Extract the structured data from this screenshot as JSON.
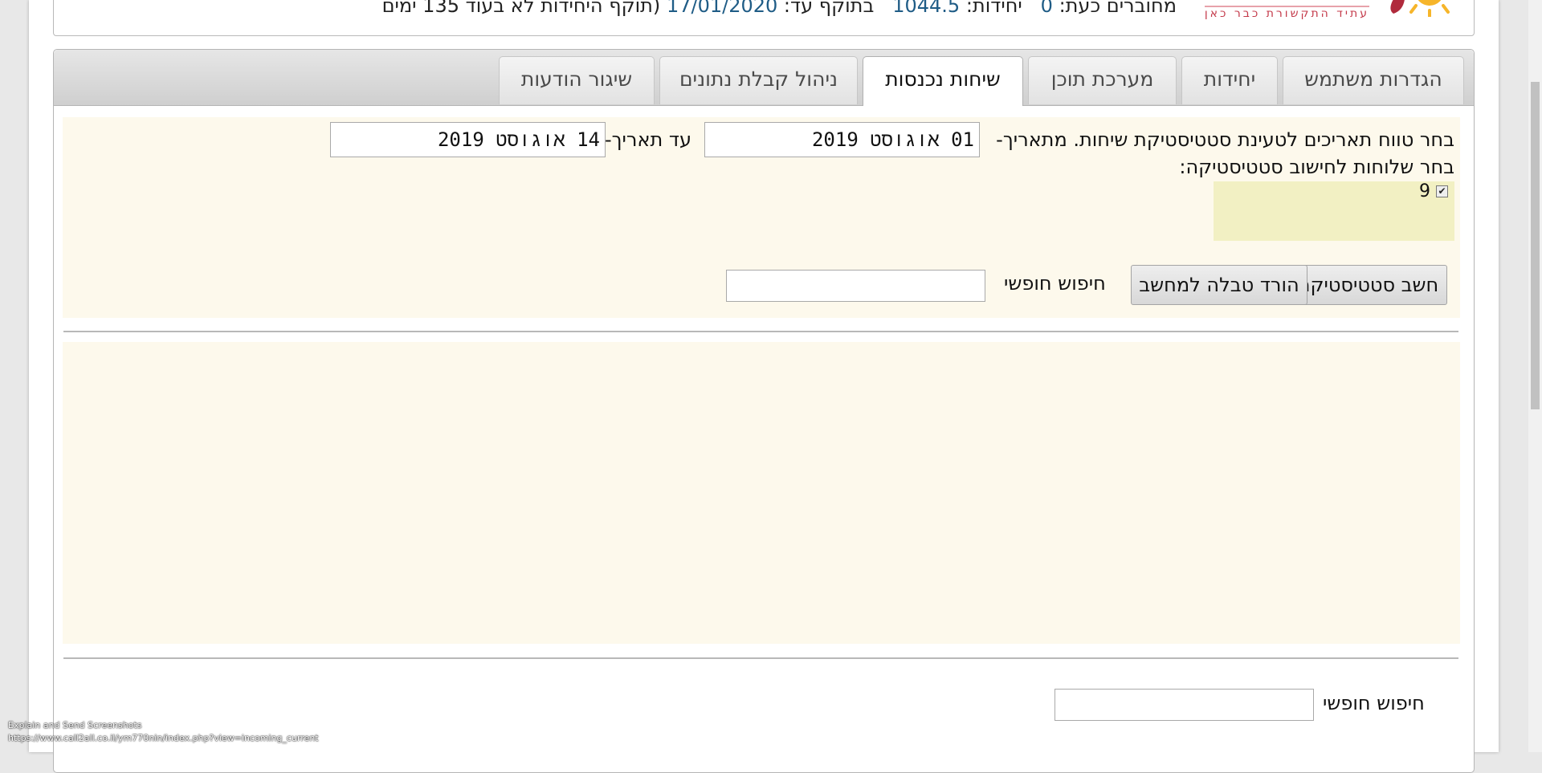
{
  "header": {
    "stats_text_1": "מחוברים כעת:",
    "stats_value_1": "0",
    "stats_text_2": "יחידות:",
    "stats_value_2": "1044.5",
    "stats_text_3": "בתוקף עד:",
    "stats_value_3": "17/01/2020",
    "stats_text_4": "(תוקף היחידות לא בעוד 135 ימים",
    "logo_tagline": "עתיד התקשורת כבר כאן"
  },
  "tabs": [
    {
      "label": "הגדרות משתמש",
      "active": false
    },
    {
      "label": "יחידות",
      "active": false
    },
    {
      "label": "מערכת תוכן",
      "active": false
    },
    {
      "label": "שיחות נכנסות",
      "active": true
    },
    {
      "label": "ניהול קבלת נתונים",
      "active": false
    },
    {
      "label": "שיגור הודעות",
      "active": false
    }
  ],
  "form": {
    "range_label": "בחר טווח תאריכים לטעינת סטטיסטיקת שיחות. מתאריך-",
    "from_date": "01 אוגוסט 2019",
    "to_label": "עד תאריך-",
    "to_date": "14 אוגוסט 2019",
    "senders_label": "בחר שלוחות לחישוב סטטיסטיקה:",
    "sender_option": "9",
    "sender_checked": true,
    "calc_button": "חשב סטטיסטיקה",
    "download_button": "הורד טבלה למחשב",
    "free_search_label": "חיפוש חופשי",
    "free_search_value": ""
  },
  "bottom": {
    "free_search_label": "חיפוש חופשי",
    "free_search_value": ""
  },
  "status_overlay": {
    "line1": "Explain and Send Screenshots",
    "line2": "https://www.call2all.co.il/ym770nin/index.php?view=incoming_current"
  }
}
